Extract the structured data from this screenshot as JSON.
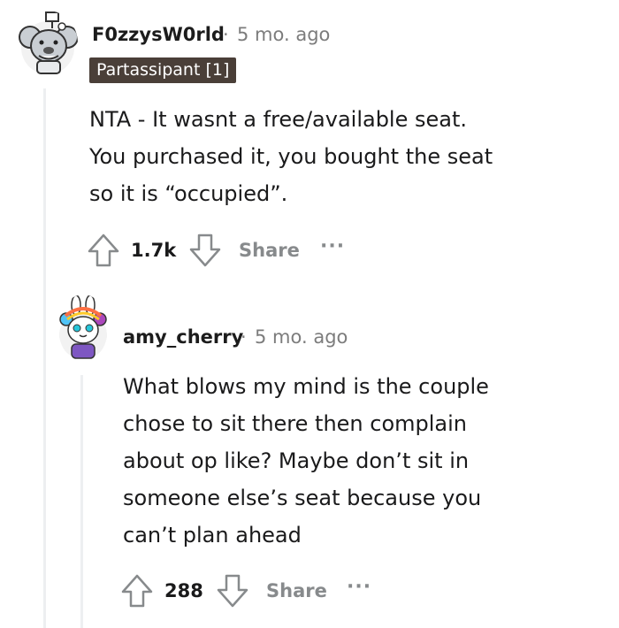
{
  "comment1": {
    "username": "F0zzysW0rld",
    "separator": "·",
    "time": "5 mo. ago",
    "flair": "Partassipant [1]",
    "body": [
      "NTA - It wasnt a free/available seat.",
      "You purchased it, you bought the seat",
      "so it is “occupied”."
    ],
    "votes": "1.7k",
    "share_label": "Share",
    "more_label": "···"
  },
  "comment2": {
    "username": "amy_cherry",
    "separator": "·",
    "time": "5 mo. ago",
    "body": [
      "What blows my mind is the couple",
      "chose to sit there then complain",
      "about op like? Maybe don’t sit in",
      "someone else’s seat because you",
      "can’t plan ahead"
    ],
    "votes": "288",
    "share_label": "Share",
    "more_label": "···"
  },
  "icons": {
    "upvote": "upvote-arrow-icon",
    "downvote": "downvote-arrow-icon"
  }
}
